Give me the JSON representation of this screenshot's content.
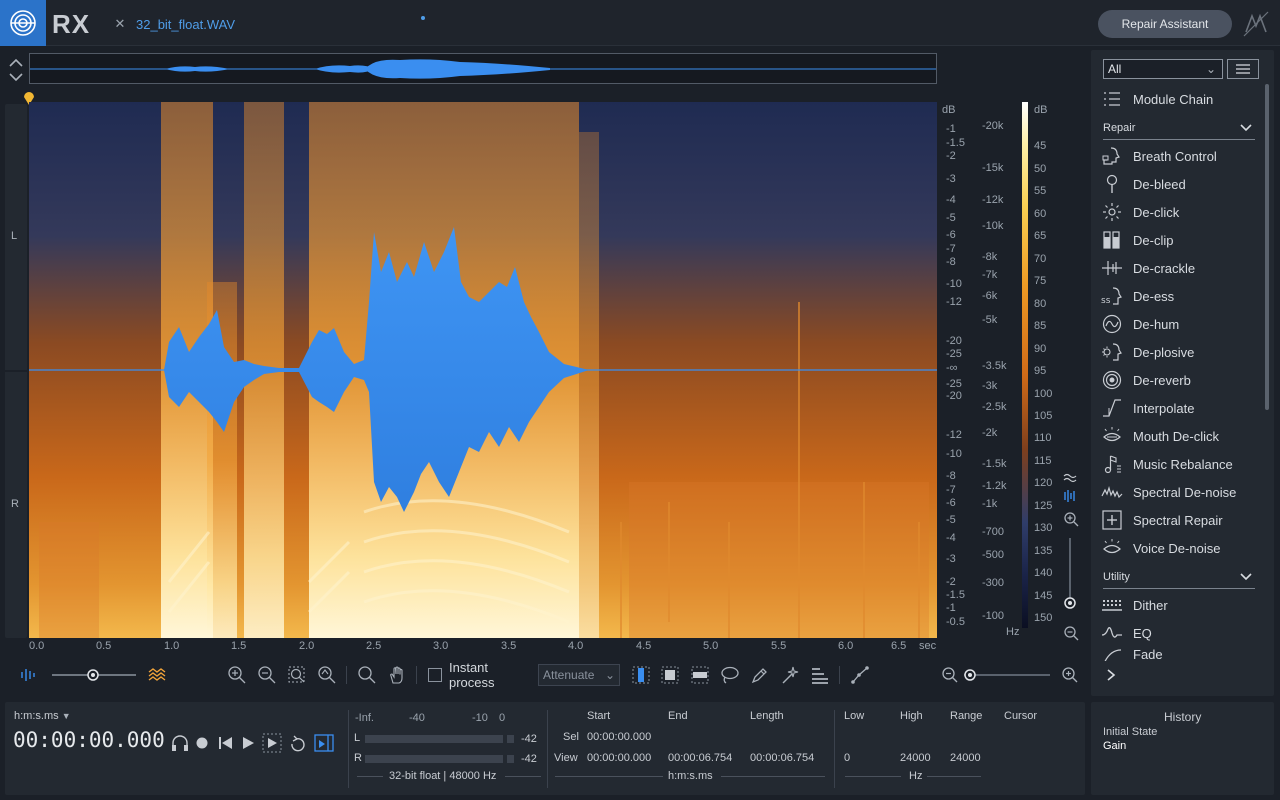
{
  "app": {
    "name": "RX",
    "file_tab": "32_bit_float.WAV",
    "repair_assistant": "Repair Assistant"
  },
  "channels": {
    "left": "L",
    "right": "R"
  },
  "db_axis": {
    "header": "dB",
    "ticks": [
      "-1",
      "-1.5",
      "-2",
      "-3",
      "-4",
      "-5",
      "-6",
      "-7",
      "-8",
      "-10",
      "-12",
      "-20",
      "-25",
      "-∞",
      "-25",
      "-20",
      "-12",
      "-10",
      "-8",
      "-7",
      "-6",
      "-5",
      "-4",
      "-3",
      "-2",
      "-1.5",
      "-1",
      "-0.5"
    ]
  },
  "hz_axis": {
    "unit": "Hz",
    "ticks": [
      "-20k",
      "-15k",
      "-12k",
      "-10k",
      "-8k",
      "-7k",
      "-6k",
      "-5k",
      "-3.5k",
      "-3k",
      "-2.5k",
      "-2k",
      "-1.5k",
      "-1.2k",
      "-1k",
      "-700",
      "-500",
      "-300",
      "-100"
    ]
  },
  "colorbar": {
    "header": "dB",
    "ticks": [
      "45",
      "50",
      "55",
      "60",
      "65",
      "70",
      "75",
      "80",
      "85",
      "90",
      "95",
      "100",
      "105",
      "110",
      "115",
      "120",
      "125",
      "130",
      "135",
      "140",
      "145",
      "150"
    ]
  },
  "time_axis": {
    "ticks": [
      "0.0",
      "0.5",
      "1.0",
      "1.5",
      "2.0",
      "2.5",
      "3.0",
      "3.5",
      "4.0",
      "4.5",
      "5.0",
      "5.5",
      "6.0",
      "6.5"
    ],
    "unit": "sec"
  },
  "toolbar": {
    "instant_process": "Instant process",
    "mode": "Attenuate"
  },
  "transport": {
    "format_label": "h:m:s.ms",
    "timecode": "00:00:00.000"
  },
  "meters": {
    "scale": [
      "-Inf.",
      "-40",
      "-10",
      "0"
    ],
    "left_label": "L",
    "right_label": "R",
    "left_peak": "-42",
    "right_peak": "-42",
    "format": "32-bit float | 48000 Hz"
  },
  "selection": {
    "headers": {
      "start": "Start",
      "end": "End",
      "length": "Length"
    },
    "sel_label": "Sel",
    "sel_start": "00:00:00.000",
    "view_label": "View",
    "view_start": "00:00:00.000",
    "view_end": "00:00:06.754",
    "view_length": "00:00:06.754",
    "unit": "h:m:s.ms"
  },
  "frequency": {
    "headers": {
      "low": "Low",
      "high": "High",
      "range": "Range",
      "cursor": "Cursor"
    },
    "low": "0",
    "high": "24000",
    "range": "24000",
    "unit": "Hz"
  },
  "history": {
    "title": "History",
    "items": [
      "Initial State",
      "Gain"
    ]
  },
  "module_panel": {
    "filter": "All",
    "module_chain": "Module Chain",
    "repair_header": "Repair",
    "repair_items": [
      "Breath Control",
      "De-bleed",
      "De-click",
      "De-clip",
      "De-crackle",
      "De-ess",
      "De-hum",
      "De-plosive",
      "De-reverb",
      "Interpolate",
      "Mouth De-click",
      "Music Rebalance",
      "Spectral De-noise",
      "Spectral Repair",
      "Voice De-noise"
    ],
    "utility_header": "Utility",
    "utility_items": [
      "Dither",
      "EQ",
      "Fade"
    ]
  },
  "colors": {
    "accent": "#2b73c9",
    "waveform": "#3a8ef0",
    "link": "#4f9de8"
  }
}
